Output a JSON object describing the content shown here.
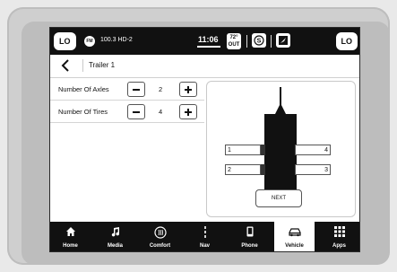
{
  "status_bar": {
    "left_temp_setting": "LO",
    "right_temp_setting": "LO",
    "band_badge": "FM",
    "station": "100.3 HD-2",
    "clock": "11:06",
    "outside_temp_value": "72°",
    "outside_temp_label": "OUT"
  },
  "header": {
    "title": "Trailer 1"
  },
  "settings": [
    {
      "label": "Number Of Axles",
      "value": "2"
    },
    {
      "label": "Number Of Tires",
      "value": "4"
    }
  ],
  "diagram": {
    "tire_labels": [
      "1",
      "4",
      "2",
      "3"
    ],
    "next_label": "NEXT"
  },
  "nav": {
    "items": [
      {
        "label": "Home",
        "icon": "home-icon"
      },
      {
        "label": "Media",
        "icon": "music-note-icon"
      },
      {
        "label": "Comfort",
        "icon": "steering-heat-icon"
      },
      {
        "label": "Nav",
        "icon": "road-icon"
      },
      {
        "label": "Phone",
        "icon": "phone-icon"
      },
      {
        "label": "Vehicle",
        "icon": "car-icon"
      },
      {
        "label": "Apps",
        "icon": "grid-icon"
      }
    ],
    "active": "Vehicle"
  }
}
